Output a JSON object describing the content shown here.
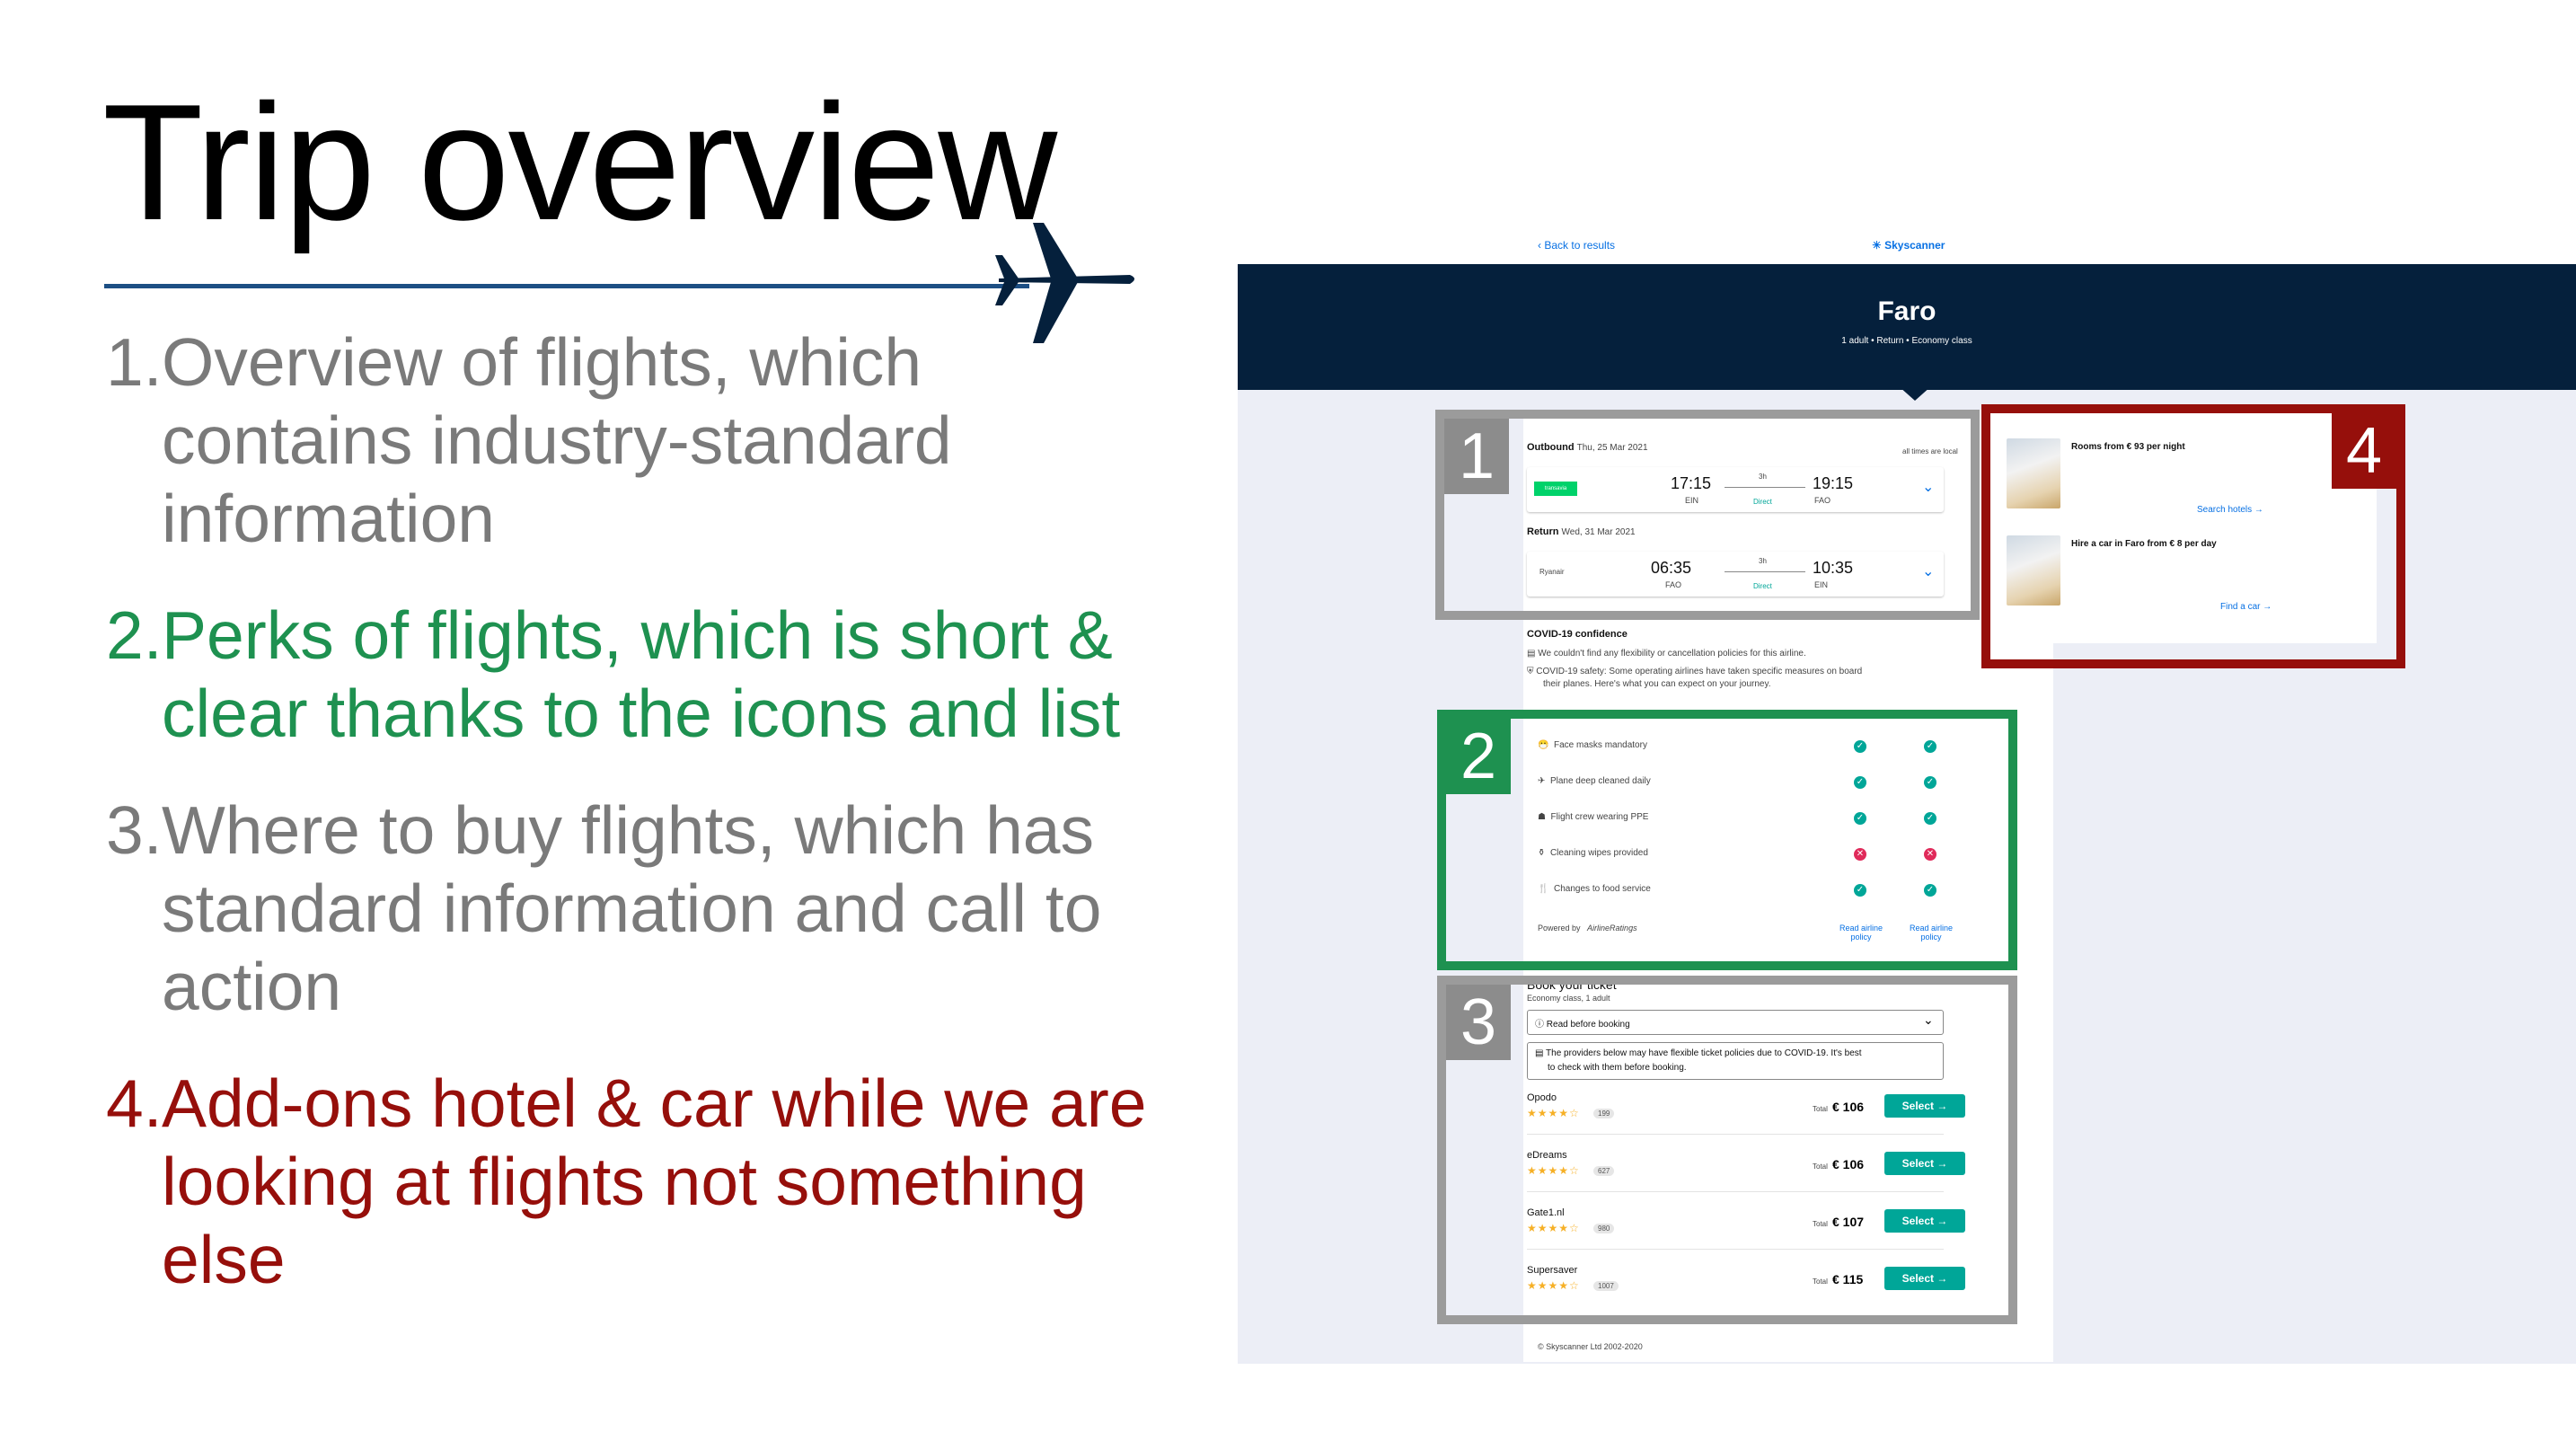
{
  "slide": {
    "title": "Trip overview",
    "points": [
      {
        "num": "1.",
        "text": "Overview of flights, which contains industry-standard information",
        "color": "#7a7a7a"
      },
      {
        "num": "2.",
        "text": "Perks of flights, which is short & clear thanks to the icons and list",
        "color": "#1e9150"
      },
      {
        "num": "3.",
        "text": "Where to buy flights, which has standard information and call to action",
        "color": "#7a7a7a"
      },
      {
        "num": "4.",
        "text": "Add-ons hotel & car while we are looking at flights not something else",
        "color": "#960f0b"
      }
    ],
    "icons": {
      "plane": "airplane-icon"
    }
  },
  "screenshot": {
    "back_link": "Back to results",
    "logo": "Skyscanner",
    "city": "Faro",
    "trip_meta": "1 adult  •  Return  •  Economy class",
    "outbound": {
      "label": "Outbound",
      "date": "Thu, 25 Mar 2021",
      "note": "all times are local",
      "airline": "transavia",
      "depart_time": "17:15",
      "depart_code": "EIN",
      "duration": "3h",
      "stops": "Direct",
      "arrive_time": "19:15",
      "arrive_code": "FAO"
    },
    "return": {
      "label": "Return",
      "date": "Wed, 31 Mar 2021",
      "airline": "Ryanair",
      "depart_time": "06:35",
      "depart_code": "FAO",
      "duration": "3h",
      "stops": "Direct",
      "arrive_time": "10:35",
      "arrive_code": "EIN"
    },
    "covid": {
      "title": "COVID-19 confidence",
      "line1": "We couldn't find any flexibility or cancellation policies for this airline.",
      "line2a": "COVID-19 safety: Some operating airlines have taken specific measures on board",
      "line2b": "their planes. Here's what you can expect on your journey.",
      "measures": [
        {
          "label": "Face masks mandatory",
          "a": "yes",
          "b": "yes"
        },
        {
          "label": "Plane deep cleaned daily",
          "a": "yes",
          "b": "yes"
        },
        {
          "label": "Flight crew wearing PPE",
          "a": "yes",
          "b": "yes"
        },
        {
          "label": "Cleaning wipes provided",
          "a": "no",
          "b": "no"
        },
        {
          "label": "Changes to food service",
          "a": "yes",
          "b": "yes"
        }
      ],
      "powered_by": "Powered by",
      "powered_brand": "AirlineRatings",
      "policy_link": "Read airline policy"
    },
    "book": {
      "title": "Book your ticket",
      "subtitle": "Economy class, 1 adult",
      "dropdown": "Read before booking",
      "notice_a": "The providers below may have flexible ticket policies due to COVID-19. It's best",
      "notice_b": "to check with them before booking.",
      "total_label": "Total",
      "select_label": "Select →",
      "providers": [
        {
          "name": "Opodo",
          "stars": 3.5,
          "reviews": "199",
          "price": "€ 106"
        },
        {
          "name": "eDreams",
          "stars": 3.5,
          "reviews": "627",
          "price": "€ 106"
        },
        {
          "name": "Gate1.nl",
          "stars": 3.5,
          "reviews": "980",
          "price": "€ 107"
        },
        {
          "name": "Supersaver",
          "stars": 4,
          "reviews": "1007",
          "price": "€ 115"
        }
      ]
    },
    "addons": {
      "hotel_text": "Rooms from € 93 per night",
      "hotel_link": "Search hotels →",
      "car_text": "Hire a car in Faro from € 8 per day",
      "car_link": "Find a car →"
    },
    "footer": "© Skyscanner Ltd 2002-2020",
    "frames": [
      "1",
      "2",
      "3",
      "4"
    ]
  }
}
